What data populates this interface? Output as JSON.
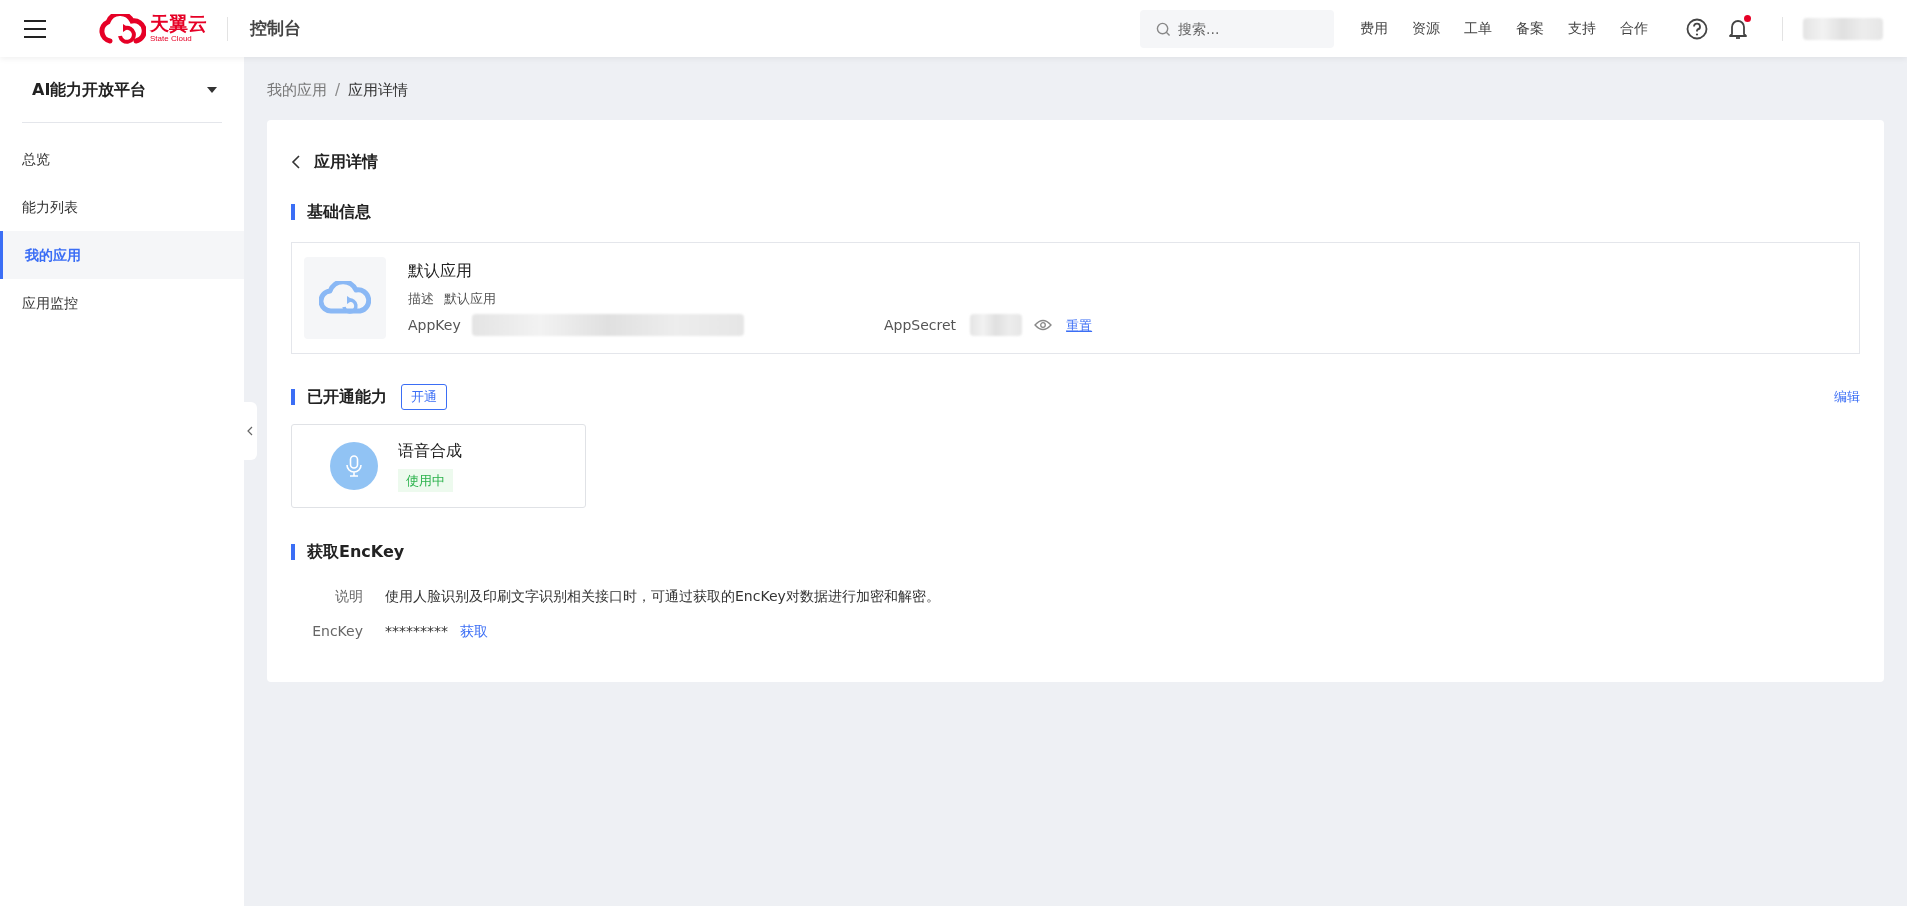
{
  "header": {
    "brand": "天翼云",
    "brand_sub": "State Cloud",
    "title": "控制台",
    "search": {
      "placeholder": "搜索..."
    },
    "nav": [
      "费用",
      "资源",
      "工单",
      "备案",
      "支持",
      "合作"
    ],
    "notification_dot": true
  },
  "sidebar": {
    "title": "AI能力开放平台",
    "items": [
      {
        "label": "总览",
        "selected": false
      },
      {
        "label": "能力列表",
        "selected": false
      },
      {
        "label": "我的应用",
        "selected": true
      },
      {
        "label": "应用监控",
        "selected": false
      }
    ]
  },
  "breadcrumb": {
    "separator": "/",
    "items": [
      {
        "label": "我的应用",
        "current": false
      },
      {
        "label": "应用详情",
        "current": true
      }
    ]
  },
  "page_title": "应用详情",
  "basic_info": {
    "heading": "基础信息",
    "app_name": "默认应用",
    "description_label": "描述",
    "description": "默认应用",
    "appkey_label": "AppKey",
    "appsecret_label": "AppSecret",
    "reset_link": "重置"
  },
  "capabilities": {
    "heading": "已开通能力",
    "open_button": "开通",
    "edit_link": "编辑",
    "items": [
      {
        "name": "语音合成",
        "status": "使用中"
      }
    ]
  },
  "enckey": {
    "heading": "获取EncKey",
    "note_label": "说明",
    "note": "使用人脸识别及印刷文字识别相关接口时，可通过获取的EncKey对数据进行加密和解密。",
    "key_label": "EncKey",
    "key_value": "*********",
    "get_link": "获取"
  }
}
